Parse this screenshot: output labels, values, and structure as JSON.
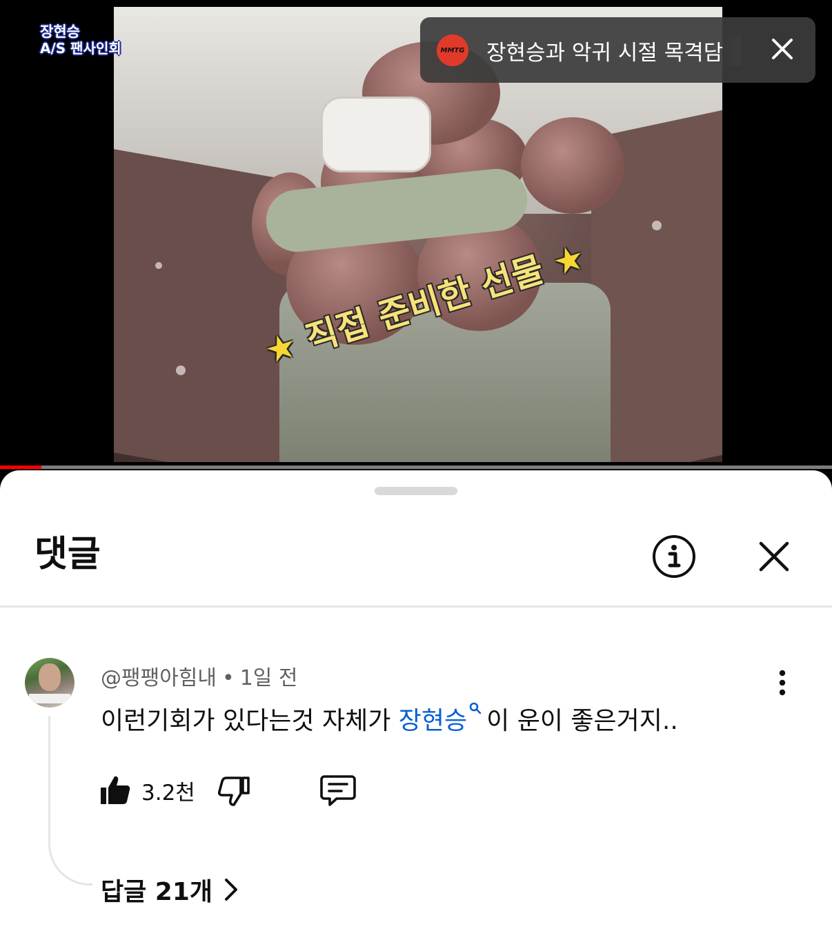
{
  "video": {
    "channel_logo_line1": "장현승",
    "channel_logo_line2": "A/S 팬사인회",
    "overlay_caption": "직접 준비한 선물",
    "progress_fraction": 0.05
  },
  "related_chip": {
    "badge_text": "MMTG",
    "title": "장현승과 악귀 시절 목격담",
    "icons": {
      "close": "close-icon"
    }
  },
  "panel": {
    "title": "댓글",
    "icons": {
      "info": "info-icon",
      "close": "close-icon"
    }
  },
  "comment": {
    "author": "@팽팽아힘내",
    "separator": "•",
    "time": "1일 전",
    "text_before": "이런기회가 있다는것 자체가 ",
    "mention": "장현승",
    "text_after": "이 운이 좋은거지..",
    "like_count": "3.2천",
    "replies_label": "답글 21개",
    "icons": {
      "like": "thumb-up-icon",
      "dislike": "thumb-down-icon",
      "reply": "reply-icon",
      "more": "more-vert-icon",
      "mention": "search-icon",
      "replies": "chevron-right-icon"
    }
  },
  "colors": {
    "progress": "#ff0000",
    "mention": "#065fd4",
    "caption": "#f7e27a",
    "chip_badge": "#e23a2a"
  }
}
